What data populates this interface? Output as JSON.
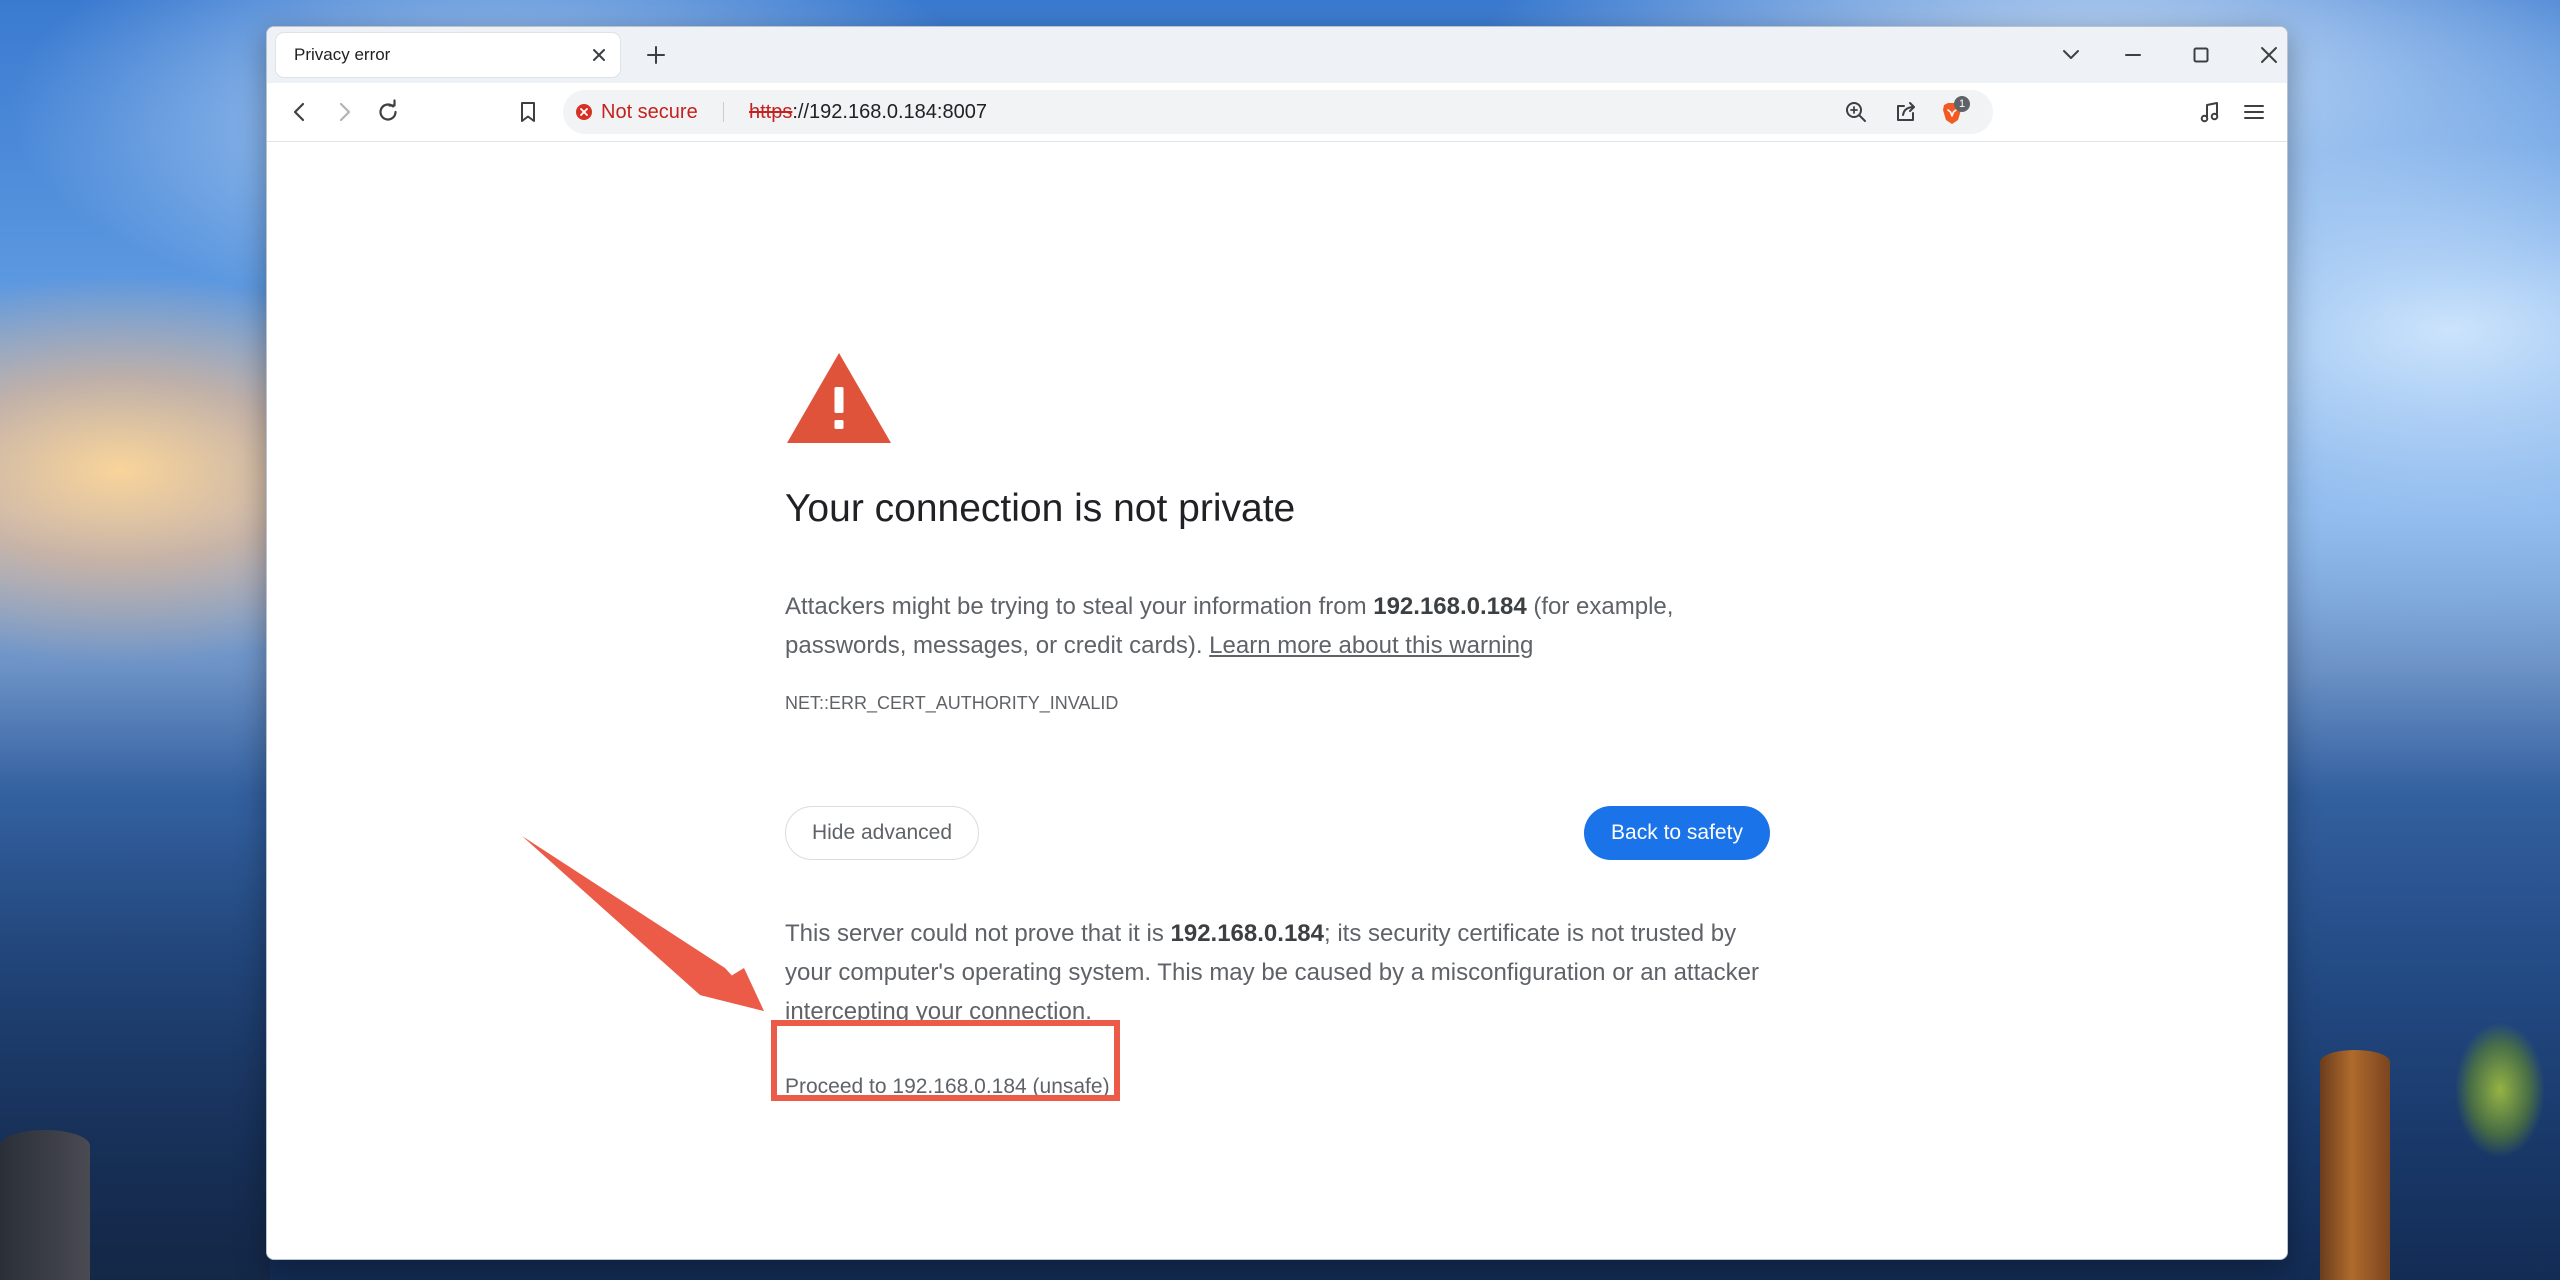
{
  "browser": {
    "tab": {
      "title": "Privacy error"
    },
    "address_bar": {
      "security_label": "Not secure",
      "url_scheme": "https",
      "url_rest": "://192.168.0.184:8007"
    },
    "shields_badge_count": "1",
    "icons": {
      "tab_close": "close-icon",
      "new_tab": "plus-icon",
      "tab_search": "chevron-down-icon",
      "minimize": "minimize-icon",
      "maximize": "maximize-icon",
      "close_window": "close-icon",
      "back": "arrow-left-icon",
      "forward": "arrow-right-icon",
      "reload": "reload-icon",
      "bookmark": "bookmark-icon",
      "zoom": "zoom-icon",
      "share": "share-icon",
      "shields": "brave-lion-icon",
      "media": "music-note-icon",
      "menu": "hamburger-menu-icon"
    }
  },
  "interstitial": {
    "heading": "Your connection is not private",
    "intro": {
      "before": "Attackers might be trying to steal your information from ",
      "host": "192.168.0.184",
      "after": " (for example, passwords, messages, or credit cards). ",
      "learn_more": "Learn more about this warning"
    },
    "error_code": "NET::ERR_CERT_AUTHORITY_INVALID",
    "hide_advanced_label": "Hide advanced",
    "back_to_safety_label": "Back to safety",
    "details": {
      "before": "This server could not prove that it is ",
      "host": "192.168.0.184",
      "after": "; its security certificate is not trusted by your computer's operating system. This may be caused by a misconfiguration or an attacker intercepting your connection."
    },
    "proceed_link": "Proceed to 192.168.0.184 (unsafe)"
  },
  "colors": {
    "warning_red": "#e0533b",
    "not_secure_red": "#c5221f",
    "primary_blue": "#1a73e8",
    "annotation_red": "#ec5a48",
    "brave_orange": "#f15a22"
  }
}
